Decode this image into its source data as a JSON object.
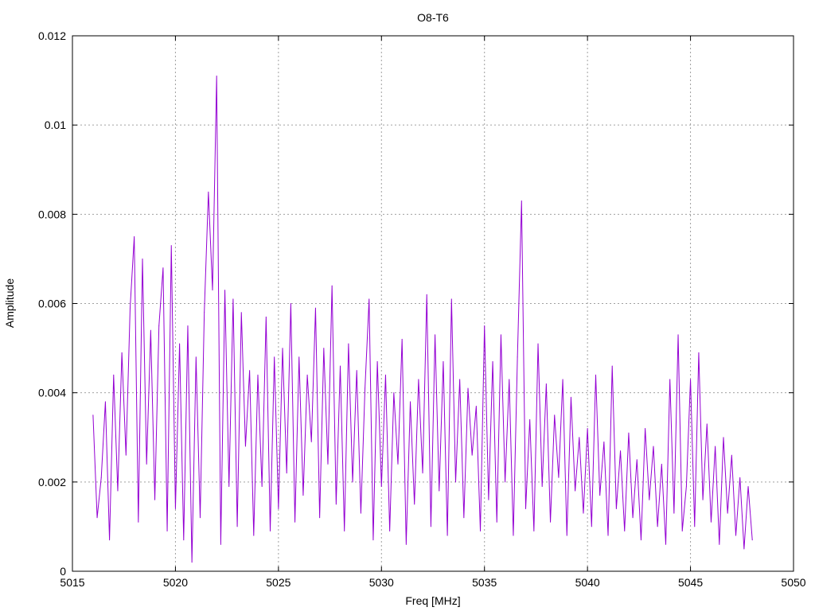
{
  "chart_data": {
    "type": "line",
    "title": "O8-T6",
    "xlabel": "Freq [MHz]",
    "ylabel": "Amplitude",
    "xlim": [
      5015,
      5050
    ],
    "ylim": [
      0,
      0.012
    ],
    "grid": true,
    "legend": "none",
    "x_ticks": [
      "5015",
      "5020",
      "5025",
      "5030",
      "5035",
      "5040",
      "5045",
      "5050"
    ],
    "y_ticks": [
      "0",
      "0.002",
      "0.004",
      "0.006",
      "0.008",
      "0.01",
      "0.012"
    ],
    "series": [
      {
        "name": "O8-T6",
        "color": "#9400D3",
        "x_start": 5016.0,
        "x_step": 0.2,
        "values": [
          0.0035,
          0.0012,
          0.0021,
          0.0038,
          0.0007,
          0.0044,
          0.0018,
          0.0049,
          0.0026,
          0.0059,
          0.0075,
          0.0011,
          0.007,
          0.0024,
          0.0054,
          0.0016,
          0.0055,
          0.0068,
          0.0009,
          0.0073,
          0.0014,
          0.0051,
          0.0007,
          0.0055,
          0.0002,
          0.0048,
          0.0012,
          0.0058,
          0.0085,
          0.0063,
          0.0111,
          0.0006,
          0.0063,
          0.0019,
          0.0061,
          0.001,
          0.0058,
          0.0028,
          0.0045,
          0.0008,
          0.0044,
          0.0019,
          0.0057,
          0.0009,
          0.0048,
          0.0014,
          0.005,
          0.0022,
          0.006,
          0.0011,
          0.0048,
          0.0017,
          0.0044,
          0.0029,
          0.0059,
          0.0012,
          0.005,
          0.0024,
          0.0064,
          0.0015,
          0.0046,
          0.0009,
          0.0051,
          0.002,
          0.0045,
          0.0013,
          0.0041,
          0.0061,
          0.0007,
          0.0047,
          0.0019,
          0.0044,
          0.0009,
          0.004,
          0.0024,
          0.0052,
          0.0006,
          0.0038,
          0.0015,
          0.0043,
          0.0022,
          0.0062,
          0.001,
          0.0053,
          0.0018,
          0.0047,
          0.0008,
          0.0061,
          0.002,
          0.0043,
          0.0012,
          0.0041,
          0.0026,
          0.0037,
          0.0009,
          0.0055,
          0.0016,
          0.0047,
          0.0011,
          0.0053,
          0.002,
          0.0043,
          0.0008,
          0.0048,
          0.0083,
          0.0014,
          0.0034,
          0.0009,
          0.0051,
          0.0019,
          0.0042,
          0.0011,
          0.0035,
          0.0021,
          0.0043,
          0.0008,
          0.0039,
          0.0018,
          0.003,
          0.0013,
          0.0032,
          0.001,
          0.0044,
          0.0017,
          0.0029,
          0.0008,
          0.0046,
          0.0014,
          0.0027,
          0.0009,
          0.0031,
          0.0012,
          0.0025,
          0.0007,
          0.0032,
          0.0016,
          0.0028,
          0.001,
          0.0024,
          0.0006,
          0.0043,
          0.0013,
          0.0053,
          0.0009,
          0.0019,
          0.0043,
          0.001,
          0.0049,
          0.0016,
          0.0033,
          0.0011,
          0.0028,
          0.0006,
          0.003,
          0.0013,
          0.0026,
          0.0008,
          0.0021,
          0.0005,
          0.0019,
          0.0007
        ]
      }
    ]
  }
}
